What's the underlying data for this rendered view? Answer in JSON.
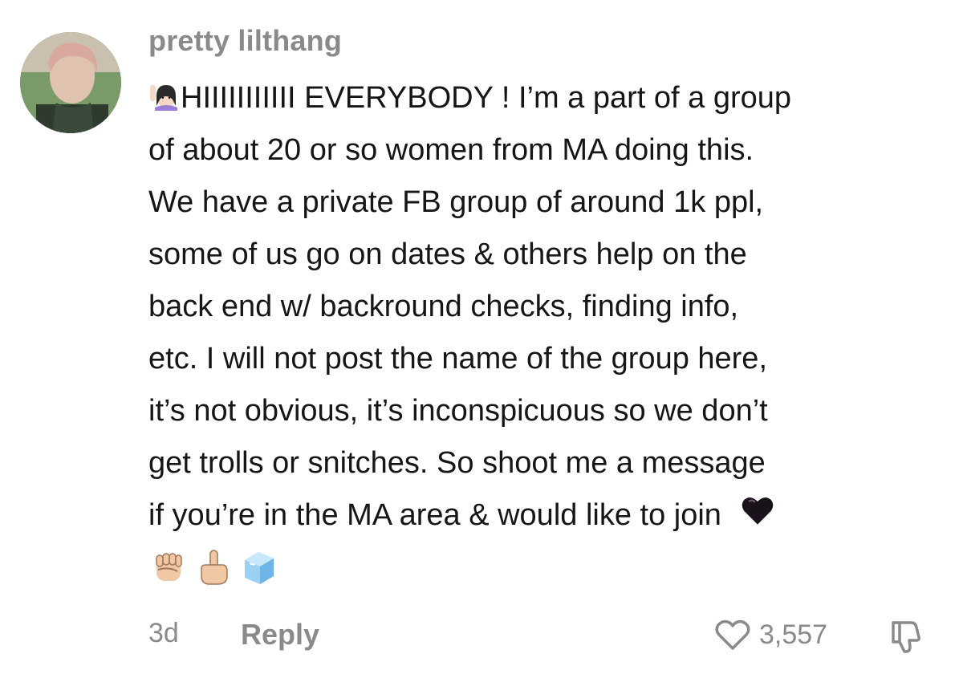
{
  "comment": {
    "username": "pretty lilthang",
    "body_first_line": "HIIIIIIIIIII EVERYBODY ! I’m a part of a group",
    "body_lines": [
      "of about 20 or so women from MA doing this.",
      "We have a private FB group of around 1k ppl,",
      "some of us go on dates & others help on the",
      "back end w/ backround checks, finding info,",
      "etc. I will not post the name of the group here,",
      "it’s not obvious, it’s inconspicuous so we don’t",
      "get trolls or snitches. So shoot me a message",
      "if you’re in the MA area & would like to join"
    ],
    "leading_emoji": "woman-raising-hand-icon",
    "trailing_emoji": "black-heart-icon",
    "emoji_row": [
      "raised-fist-icon",
      "middle-finger-icon",
      "ice-cube-icon"
    ],
    "time": "3d",
    "reply_label": "Reply",
    "like_count": "3,557"
  },
  "colors": {
    "text": "#161616",
    "muted": "#8a8a8a",
    "background": "#ffffff"
  }
}
